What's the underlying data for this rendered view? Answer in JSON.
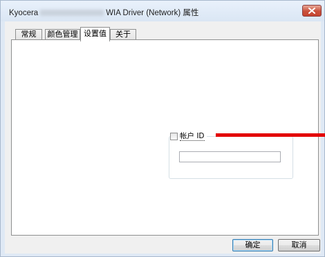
{
  "window": {
    "title_prefix": "Kyocera",
    "title_suffix": "WIA Driver (Network) 属性"
  },
  "tabs": [
    {
      "label": "常规"
    },
    {
      "label": "颜色管理"
    },
    {
      "label": "设置值"
    },
    {
      "label": "关于"
    }
  ],
  "settings": {
    "account_id_label": "帐户 ID",
    "account_id_checked": false,
    "account_id_value": ""
  },
  "buttons": {
    "ok": "确定",
    "cancel": "取消"
  },
  "colors": {
    "annotation_arrow": "#e30000",
    "close_button": "#c64530"
  }
}
